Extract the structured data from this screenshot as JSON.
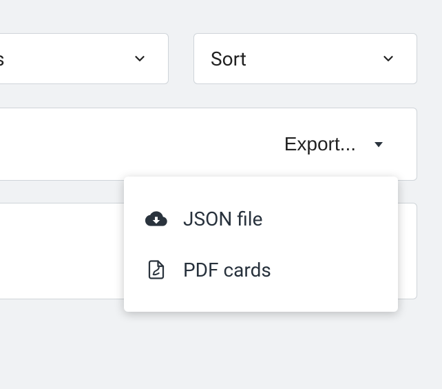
{
  "filters": {
    "categories": {
      "label": "ories"
    },
    "sort": {
      "label": "Sort"
    }
  },
  "toolbar": {
    "export_label": "Export..."
  },
  "export_menu": {
    "items": [
      {
        "label": "JSON file",
        "icon": "cloud-download-icon"
      },
      {
        "label": "PDF cards",
        "icon": "pdf-file-icon"
      }
    ]
  }
}
